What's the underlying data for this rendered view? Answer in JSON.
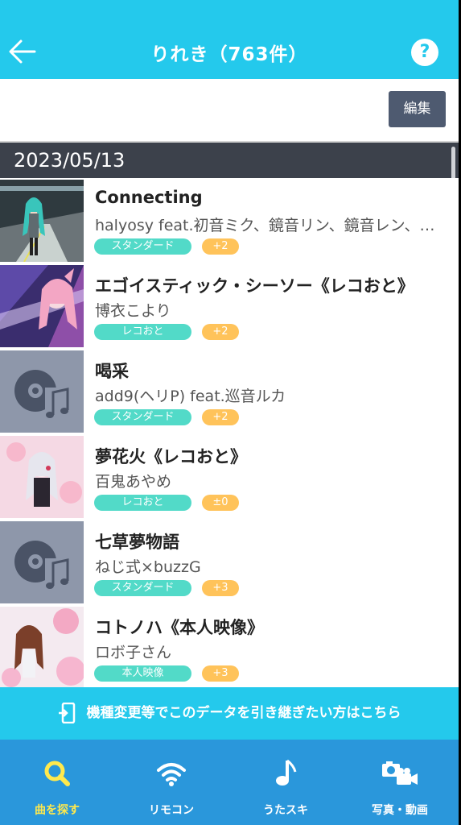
{
  "header": {
    "title": "りれき（763件）",
    "help_label": "?"
  },
  "toolbar": {
    "edit_label": "編集"
  },
  "history": {
    "date": "2023/05/13",
    "items": [
      {
        "song": "Connecting",
        "artist": "halyosy feat.初音ミク、鏡音リン、鏡音レン、巡音ルカ、MEIKO、KAITO",
        "category": "スタンダード",
        "key": "+2",
        "thumb": "jacket-image"
      },
      {
        "song": "エゴイスティック・シーソー《レコおと》",
        "artist": "博衣こより",
        "category": "レコおと",
        "key": "+2",
        "thumb": "jacket-image"
      },
      {
        "song": "喝采",
        "artist": "add9(ヘリP) feat.巡音ルカ",
        "category": "スタンダード",
        "key": "+2",
        "thumb": "no-image-music-icon"
      },
      {
        "song": "夢花火《レコおと》",
        "artist": "百鬼あやめ",
        "category": "レコおと",
        "key": "±0",
        "thumb": "jacket-image"
      },
      {
        "song": "七草夢物語",
        "artist": "ねじ式×buzzG",
        "category": "スタンダード",
        "key": "+3",
        "thumb": "no-image-music-icon"
      },
      {
        "song": "コトノハ《本人映像》",
        "artist": "ロボ子さん",
        "category": "本人映像",
        "key": "+3",
        "thumb": "jacket-image"
      }
    ]
  },
  "banner": {
    "text": "機種変更等でこのデータを引き継ぎたい方はこちら",
    "icon": "phone-transfer-icon"
  },
  "tabs": [
    {
      "label": "曲を探す",
      "icon": "search-icon",
      "active": true
    },
    {
      "label": "リモコン",
      "icon": "wifi-icon",
      "active": false
    },
    {
      "label": "うたスキ",
      "icon": "music-note-icon",
      "active": false
    },
    {
      "label": "写真・動画",
      "icon": "camera-video-icon",
      "active": false
    }
  ],
  "colors": {
    "header": "#24c9ec",
    "tabbar": "#2a97db",
    "active_tab": "#ffe94d",
    "tag": "#52dac8",
    "key_badge": "#ffc35a",
    "date_bar": "#3c414b"
  }
}
